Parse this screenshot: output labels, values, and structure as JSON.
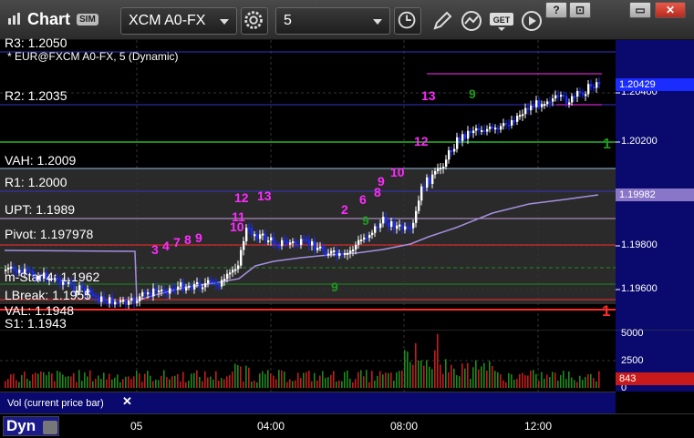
{
  "toolbar": {
    "app_title": "Chart",
    "sim_badge": "SIM",
    "symbol_value": "XCM A0-FX",
    "interval_value": "5",
    "win_help": "?",
    "win_restore": "⊡",
    "win_minimize": "▭",
    "win_close": "✕"
  },
  "chart": {
    "description": "* EUR@FXCM A0-FX, 5 (Dynamic)",
    "r3_partial": "R3: 1.2050",
    "levels": {
      "r2": "R2: 1.2035",
      "vah": "VAH: 1.2009",
      "r1": "R1: 1.2000",
      "upt": "UPT: 1.1989",
      "pivot": "Pivot: 1.1979",
      "pivot_suffix": "78",
      "mstar": "m-Star 4: 1.1962",
      "lbreak": "LBreak: 1.1955",
      "val": "VAL: 1.1948",
      "s1": "S1: 1.1943"
    },
    "price_axis": [
      "1.20400",
      "1.20200",
      "1.19800",
      "1.19600"
    ],
    "last_price_tag": "1.20429",
    "ma_tag": "1.19982",
    "colors": {
      "background": "#000000",
      "up_bar": "#ffffff",
      "down_bar": "#1a2cff",
      "magenta": "#ff2bff",
      "green": "#1e8a1e",
      "ma_line": "#a58fe0",
      "resistance": "#3535c8",
      "support_red": "#ff2b2b",
      "vol_red": "#c81a1a"
    },
    "seq_numbers_magenta": [
      "13",
      "12",
      "10",
      "9",
      "8",
      "6",
      "2",
      "11",
      "12",
      "13",
      "3",
      "4",
      "7",
      "8",
      "9",
      "10"
    ],
    "seq_numbers_green": [
      "9",
      "1",
      "9",
      "9",
      "1"
    ]
  },
  "volume": {
    "label": "Vol (current price bar)",
    "close_glyph": "✕",
    "axis": [
      "5000",
      "2500",
      "0"
    ],
    "last_tag": "843"
  },
  "time_axis": {
    "labels": [
      "05",
      "04:00",
      "08:00",
      "12:00"
    ],
    "dyn_button": "Dyn"
  }
}
